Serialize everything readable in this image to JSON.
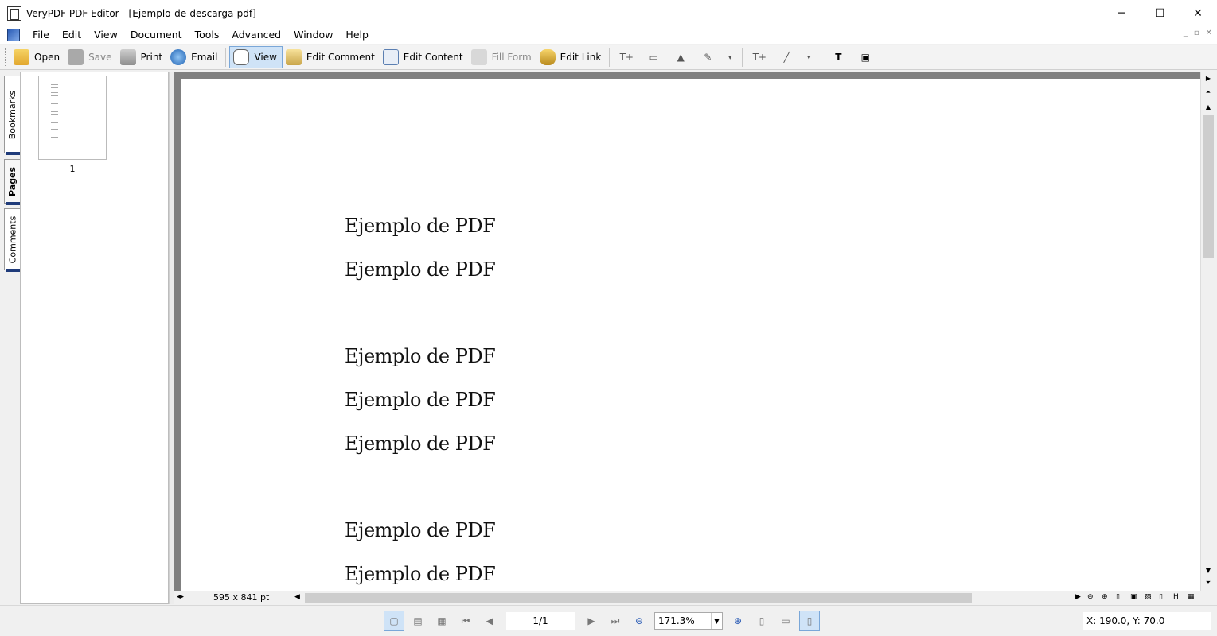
{
  "window": {
    "title": "VeryPDF PDF Editor - [Ejemplo-de-descarga-pdf]",
    "controls": [
      "─",
      "☐",
      "✕"
    ]
  },
  "menu": [
    "File",
    "Edit",
    "View",
    "Document",
    "Tools",
    "Advanced",
    "Window",
    "Help"
  ],
  "mdi_controls": [
    "_",
    "▫",
    "✕"
  ],
  "toolbar": {
    "open": "Open",
    "save": "Save",
    "print": "Print",
    "email": "Email",
    "view": "View",
    "edit_comment": "Edit Comment",
    "edit_content": "Edit Content",
    "fill_form": "Fill Form",
    "edit_link": "Edit Link"
  },
  "side_tabs": [
    "Bookmarks",
    "Pages",
    "Comments"
  ],
  "thumbnail": {
    "page_number": "1"
  },
  "document": {
    "lines": [
      "Ejemplo de PDF",
      "Ejemplo de PDF",
      "Ejemplo de PDF",
      "Ejemplo de PDF",
      "Ejemplo de PDF",
      "Ejemplo de PDF",
      "Ejemplo de PDF"
    ]
  },
  "hscroll": {
    "page_size": "595 x 841 pt"
  },
  "status": {
    "page": "1/1",
    "zoom": "171.3%",
    "coordinates": "X: 190.0, Y: 70.0"
  },
  "colors": {
    "active_button_bg": "#cfe3f7",
    "active_button_border": "#7aa7d8",
    "tab_accent": "#1f3b7a",
    "viewer_bg": "#808080"
  }
}
